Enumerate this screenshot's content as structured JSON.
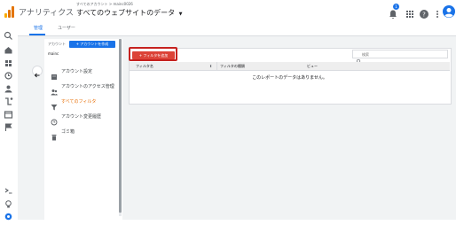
{
  "header": {
    "app_title": "アナリティクス",
    "breadcrumb": "すべてのアカウント > mainc0026",
    "property_name": "すべてのウェブサイトのデータ",
    "notification_count": "1"
  },
  "tabs": [
    {
      "label": "管理",
      "active": true
    },
    {
      "label": "ユーザー",
      "active": false
    }
  ],
  "account": {
    "label": "アカウント",
    "create_button": "+ アカウントを作成",
    "value": "mainc"
  },
  "menu": [
    {
      "label": "アカウント設定",
      "icon": "building-icon",
      "active": false
    },
    {
      "label": "アカウントのアクセス管理",
      "icon": "people-icon",
      "active": false
    },
    {
      "label": "すべてのフィルタ",
      "icon": "filter-icon",
      "active": true
    },
    {
      "label": "アカウント変更履歴",
      "icon": "history-icon",
      "active": false
    },
    {
      "label": "ゴミ箱",
      "icon": "trash-icon",
      "active": false
    }
  ],
  "filters": {
    "add_button": "+ フィルタを追加",
    "search_placeholder": "検索",
    "columns": [
      "フィルタ名",
      "フィルタの種類",
      "ビュー"
    ],
    "empty_message": "このレポートのデータはありません。"
  },
  "colors": {
    "accent": "#1a73e8",
    "active_item": "#e8710a",
    "add_button": "#dc4337",
    "highlight_border": "#c5221f"
  }
}
